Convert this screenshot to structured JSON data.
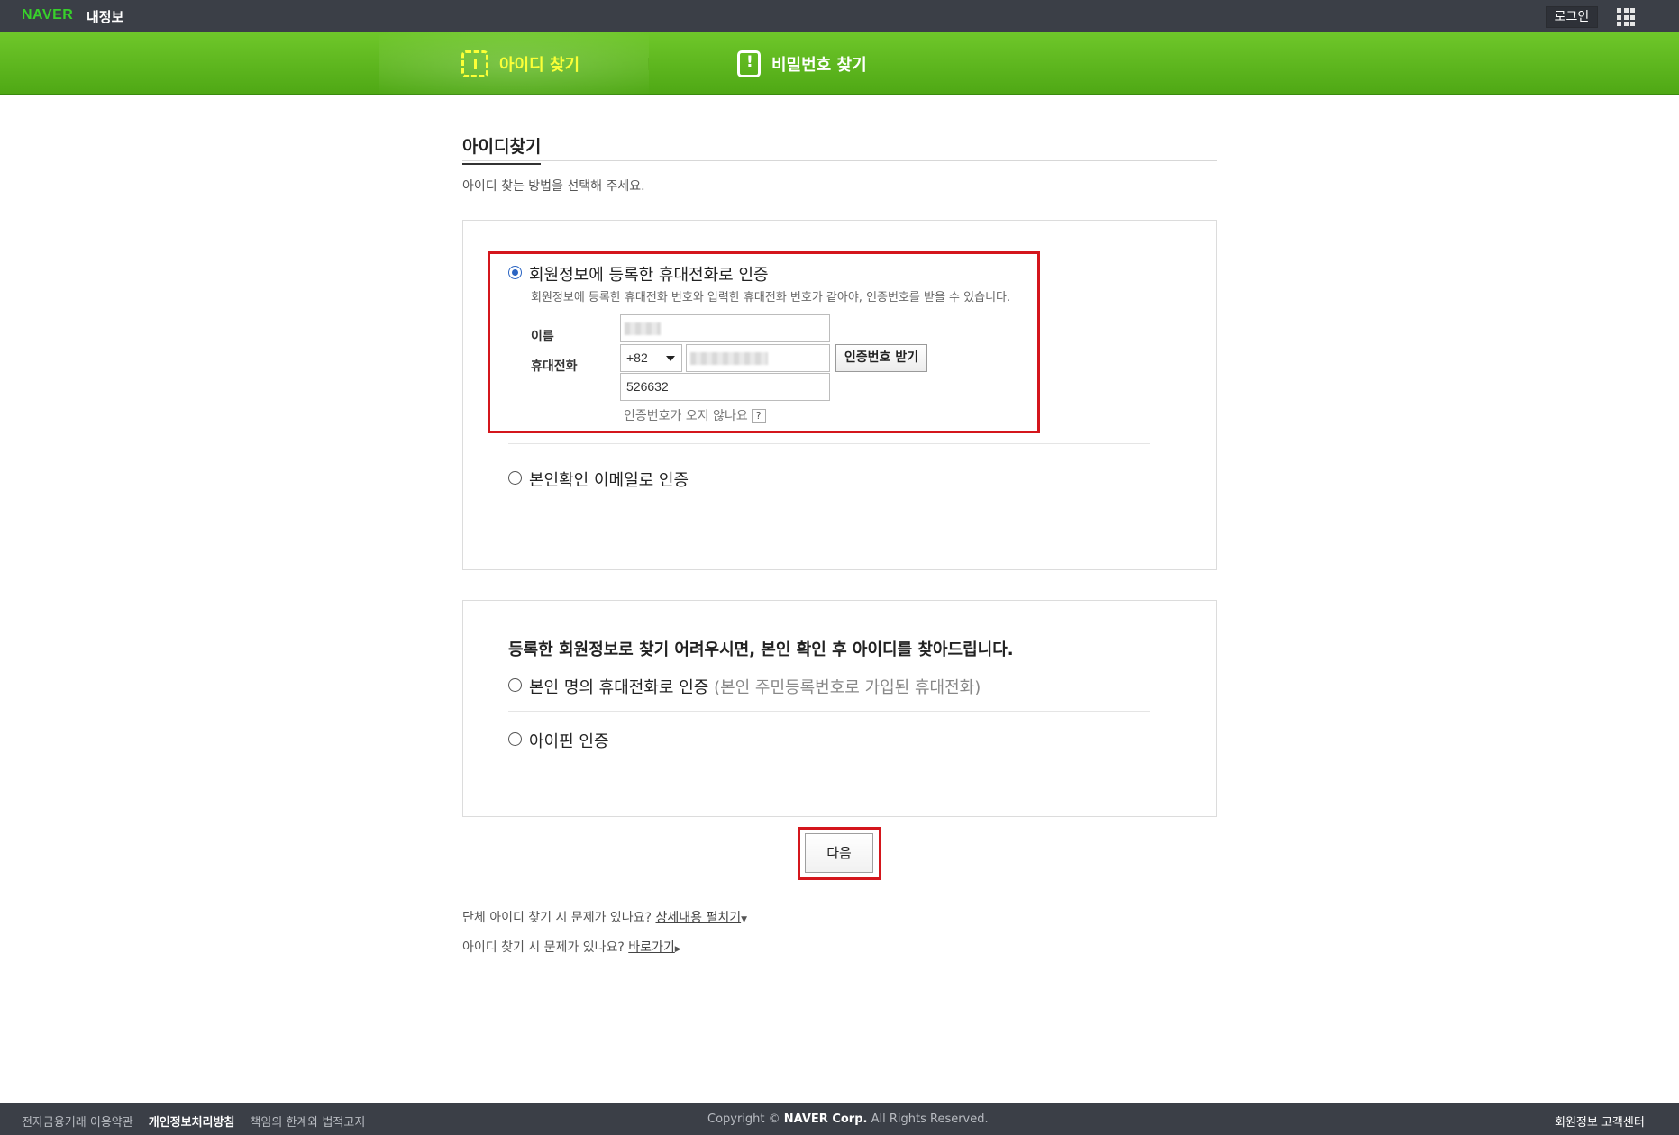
{
  "header": {
    "logo": "NAVER",
    "service": "내정보",
    "login_label": "로그인",
    "apps_icon": "grid-menu-icon"
  },
  "nav": {
    "tabs": [
      {
        "label": "아이디 찾기",
        "icon": "id-find-icon",
        "active": true
      },
      {
        "label": "비밀번호 찾기",
        "icon": "lock-alert-icon",
        "active": false
      }
    ]
  },
  "page": {
    "title": "아이디찾기",
    "description": "아이디 찾는 방법을 선택해 주세요."
  },
  "method_box": {
    "phone_option": {
      "label": "회원정보에 등록한 휴대전화로 인증",
      "description": "회원정보에 등록한 휴대전화 번호와 입력한 휴대전화 번호가 같아야, 인증번호를 받을 수 있습니다.",
      "selected": true,
      "name_label": "이름",
      "phone_label": "휴대전화",
      "country_code": "+82",
      "auth_button": "인증번호 받기",
      "auth_code": "526632",
      "help_text": "인증번호가 오지 않나요",
      "help_icon": "?"
    },
    "email_option": {
      "label": "본인확인 이메일로 인증",
      "selected": false
    }
  },
  "alt_box": {
    "heading": "등록한 회원정보로 찾기 어려우시면, 본인 확인 후 아이디를 찾아드립니다.",
    "own_phone_option": {
      "label": "본인 명의 휴대전화로 인증",
      "sub": "(본인 주민등록번호로 가입된 휴대전화)",
      "selected": false
    },
    "ipin_option": {
      "label": "아이핀 인증",
      "selected": false
    }
  },
  "next_button": "다음",
  "help_links": {
    "group_q": "단체 아이디 찾기 시 문제가 있나요?",
    "group_link": "상세내용 펼치기",
    "group_arrow": "▼",
    "id_q": "아이디 찾기 시 문제가 있나요?",
    "id_link": "바로가기",
    "id_arrow": "▶"
  },
  "footer": {
    "links": [
      "전자금융거래 이용약관",
      "개인정보처리방침",
      "책임의 한계와 법적고지"
    ],
    "copyright_prefix": "Copyright ©",
    "copyright_corp": "NAVER Corp.",
    "copyright_suffix": "All Rights Reserved.",
    "customer_center": "회원정보 고객센터"
  },
  "colors": {
    "nav_green": "#5cb61c",
    "active_tab": "#fbff37",
    "highlight_red": "#d4161c",
    "dark_bar": "#3b3f47"
  }
}
